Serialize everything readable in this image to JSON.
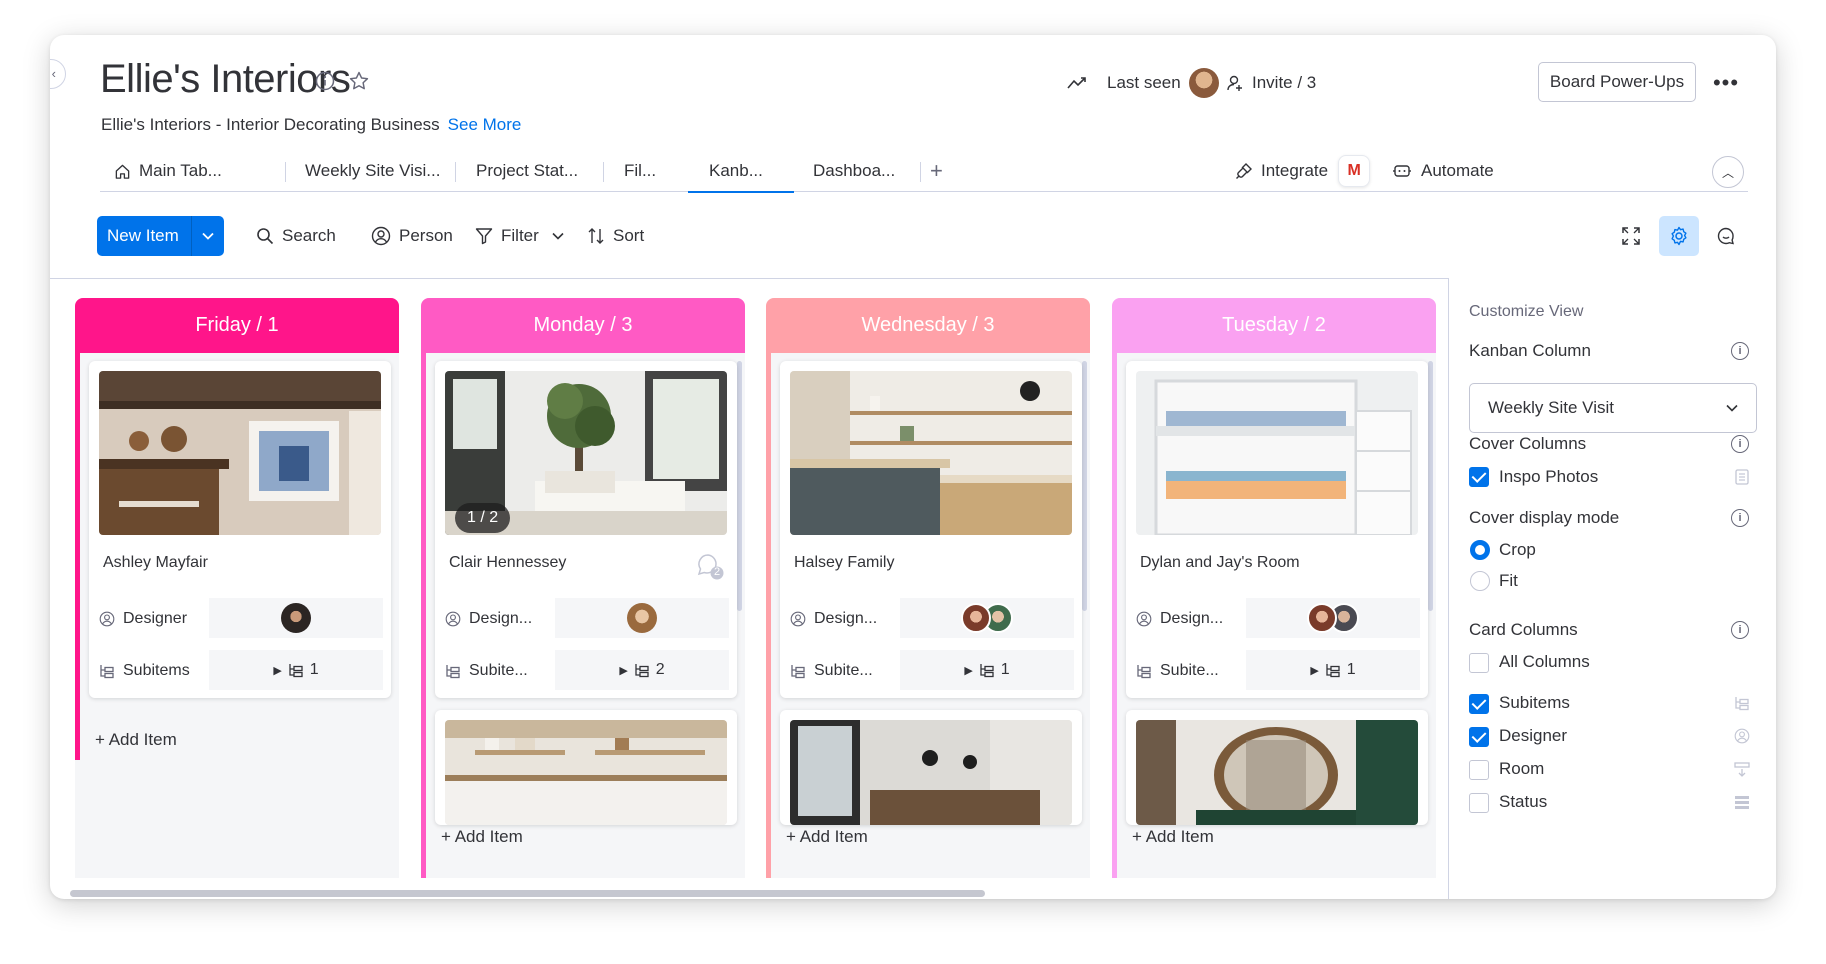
{
  "board": {
    "title": "Ellie's Interiors",
    "subtitle": "Ellie's Interiors - Interior Decorating Business",
    "see_more": "See More",
    "last_seen_label": "Last seen",
    "invite_label": "Invite / 3",
    "power_ups_label": "Board Power-Ups"
  },
  "tabs": [
    {
      "label": "Main Tab..."
    },
    {
      "label": "Weekly Site Visi..."
    },
    {
      "label": "Project Stat..."
    },
    {
      "label": "Fil..."
    },
    {
      "label": "Kanb..."
    },
    {
      "label": "Dashboa..."
    }
  ],
  "tabs_right": {
    "integrate": "Integrate",
    "automate": "Automate"
  },
  "toolbar": {
    "new_item": "New Item",
    "search": "Search",
    "person": "Person",
    "filter": "Filter",
    "sort": "Sort"
  },
  "columns": [
    {
      "header": "Friday / 1",
      "color": "#ff158a",
      "cards": [
        {
          "name": "Ashley Mayfair",
          "designer_label": "Designer",
          "subitems_label": "Subitems",
          "subitems_count": "1"
        }
      ],
      "add_item": "+ Add Item"
    },
    {
      "header": "Monday / 3",
      "color": "#ff5ac4",
      "cards": [
        {
          "name": "Clair Hennessey",
          "designer_label": "Design...",
          "subitems_label": "Subite...",
          "subitems_count": "2",
          "cover_badge": "1 / 2",
          "updates_count": "2"
        }
      ],
      "add_item": "+ Add Item"
    },
    {
      "header": "Wednesday / 3",
      "color": "#ffa1a8",
      "cards": [
        {
          "name": "Halsey Family",
          "designer_label": "Design...",
          "subitems_label": "Subite...",
          "subitems_count": "1"
        }
      ],
      "add_item": "+ Add Item"
    },
    {
      "header": "Tuesday / 2",
      "color": "#faa1f1",
      "cards": [
        {
          "name": "Dylan and Jay's Room",
          "designer_label": "Design...",
          "subitems_label": "Subite...",
          "subitems_count": "1"
        }
      ],
      "add_item": "+ Add Item"
    }
  ],
  "panel": {
    "title": "Customize View",
    "kanban_column_label": "Kanban Column",
    "kanban_column_value": "Weekly Site Visit",
    "cover_columns_label": "Cover Columns",
    "cover_column_option": "Inspo Photos",
    "cover_display_label": "Cover display mode",
    "crop_label": "Crop",
    "fit_label": "Fit",
    "card_columns_label": "Card Columns",
    "card_columns": [
      {
        "label": "All Columns",
        "checked": false
      },
      {
        "label": "Subitems",
        "checked": true
      },
      {
        "label": "Designer",
        "checked": true
      },
      {
        "label": "Room",
        "checked": false
      },
      {
        "label": "Status",
        "checked": false
      }
    ]
  },
  "colors": {
    "accent": "#0073ea",
    "text": "#323338",
    "muted": "#676879"
  }
}
